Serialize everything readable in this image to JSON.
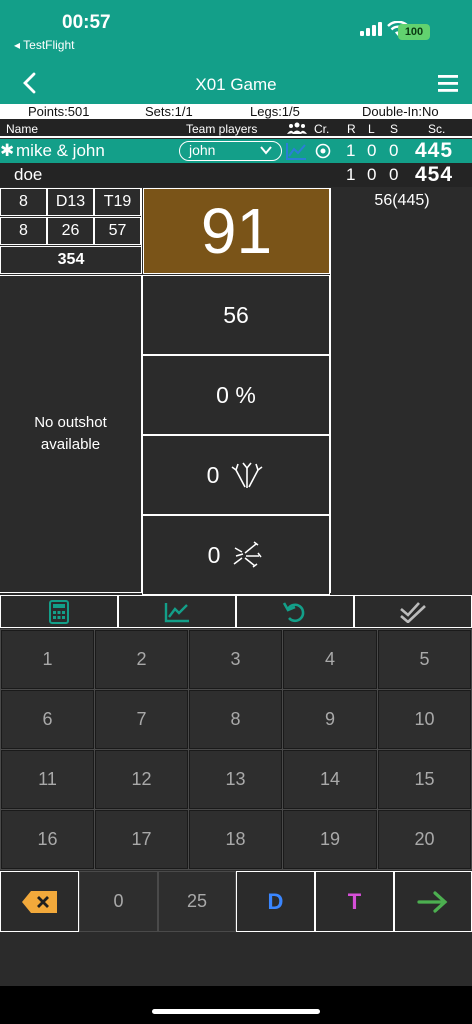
{
  "status": {
    "time": "00:57",
    "back_app": "◂ TestFlight",
    "battery": "100"
  },
  "nav": {
    "title": "X01 Game"
  },
  "info": {
    "points": "Points:501",
    "sets": "Sets:1/1",
    "legs": "Legs:1/5",
    "double_in": "Double-In:No"
  },
  "header": {
    "name": "Name",
    "team_players": "Team players",
    "cr": "Cr.",
    "r": "R",
    "l": "L",
    "s": "S",
    "sc": "Sc."
  },
  "players": [
    {
      "marker": "✱",
      "name": "mike & john",
      "team_player": "john",
      "r": "1",
      "l": "0",
      "s": "0",
      "score": "445"
    },
    {
      "name": "doe",
      "r": "1",
      "l": "0",
      "s": "0",
      "score": "454"
    }
  ],
  "darts": {
    "row1": [
      "8",
      "D13",
      "T19"
    ],
    "row2": [
      "8",
      "26",
      "57"
    ],
    "total": "354"
  },
  "current_score": "91",
  "remaining": "56(445)",
  "outshot": "No outshot available",
  "stats": {
    "value": "56",
    "percent": "0 %",
    "darts_a": "0",
    "darts_b": "0"
  },
  "keypad": {
    "numbers": [
      "1",
      "2",
      "3",
      "4",
      "5",
      "6",
      "7",
      "8",
      "9",
      "10",
      "11",
      "12",
      "13",
      "14",
      "15",
      "16",
      "17",
      "18",
      "19",
      "20"
    ],
    "zero": "0",
    "bull": "25",
    "double": "D",
    "triple": "T"
  },
  "colors": {
    "accent": "#139f89",
    "score_bg": "#7a5418",
    "double": "#3a86ff",
    "triple": "#d64fd8",
    "enter": "#4caf50",
    "backspace": "#f2a93b"
  }
}
